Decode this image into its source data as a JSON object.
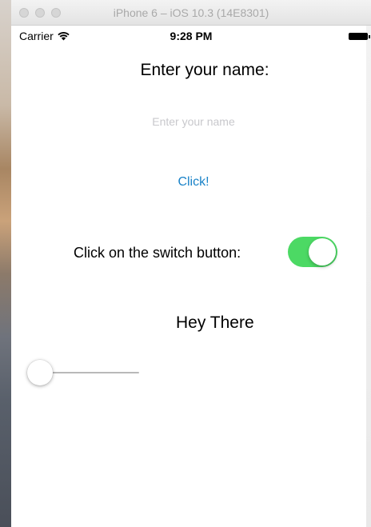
{
  "window": {
    "title": "iPhone 6 – iOS 10.3 (14E8301)"
  },
  "status_bar": {
    "carrier": "Carrier",
    "time": "9:28 PM",
    "wifi_icon": "wifi-icon",
    "battery_icon": "battery-icon"
  },
  "main": {
    "heading": "Enter your name:",
    "name_input": {
      "value": "",
      "placeholder": "Enter your name"
    },
    "click_button_label": "Click!",
    "switch_label": "Click on the switch button:",
    "switch": {
      "on": true,
      "on_color": "#4cd964"
    },
    "greeting": "Hey There",
    "slider": {
      "value": 0
    }
  },
  "colors": {
    "button_tint": "#1a83c8"
  }
}
